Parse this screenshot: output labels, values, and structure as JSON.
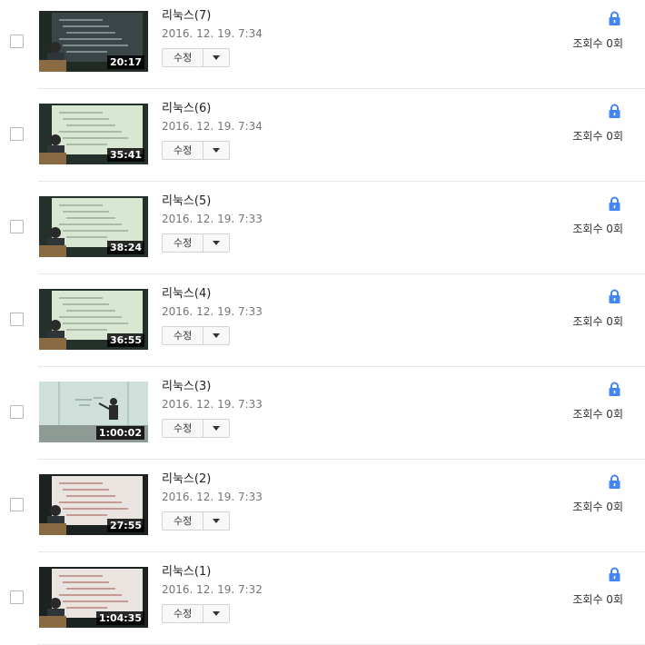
{
  "videos": [
    {
      "title": "리눅스(7)",
      "date": "2016. 12. 19. 7:34",
      "duration": "20:17",
      "edit_label": "수정",
      "views": "조회수 0회",
      "thumb": "dark"
    },
    {
      "title": "리눅스(6)",
      "date": "2016. 12. 19. 7:34",
      "duration": "35:41",
      "edit_label": "수정",
      "views": "조회수 0회",
      "thumb": "green"
    },
    {
      "title": "리눅스(5)",
      "date": "2016. 12. 19. 7:33",
      "duration": "38:24",
      "edit_label": "수정",
      "views": "조회수 0회",
      "thumb": "green"
    },
    {
      "title": "리눅스(4)",
      "date": "2016. 12. 19. 7:33",
      "duration": "36:55",
      "edit_label": "수정",
      "views": "조회수 0회",
      "thumb": "green"
    },
    {
      "title": "리눅스(3)",
      "date": "2016. 12. 19. 7:33",
      "duration": "1:00:02",
      "edit_label": "수정",
      "views": "조회수 0회",
      "thumb": "board"
    },
    {
      "title": "리눅스(2)",
      "date": "2016. 12. 19. 7:33",
      "duration": "27:55",
      "edit_label": "수정",
      "views": "조회수 0회",
      "thumb": "light"
    },
    {
      "title": "리눅스(1)",
      "date": "2016. 12. 19. 7:32",
      "duration": "1:04:35",
      "edit_label": "수정",
      "views": "조회수 0회",
      "thumb": "light"
    }
  ],
  "colors": {
    "lock": "#4285f4",
    "divider": "#e8e8e8"
  },
  "icons": {
    "privacy": "lock-icon",
    "dropdown": "chevron-down-icon"
  }
}
